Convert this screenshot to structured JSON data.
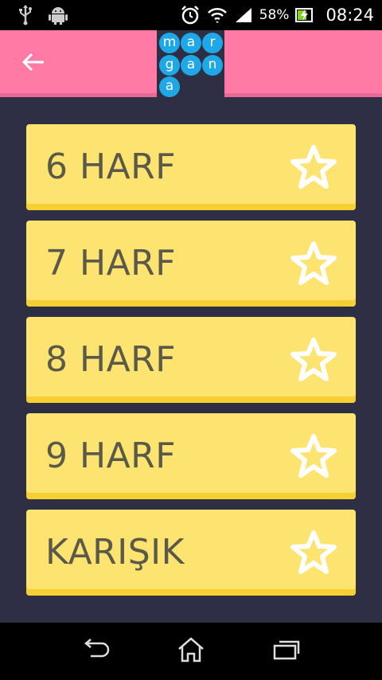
{
  "status_bar": {
    "battery_percent": "58%",
    "time": "08:24",
    "icons": [
      "usb-icon",
      "android-icon",
      "alarm-icon",
      "wifi-icon",
      "signal-icon",
      "battery-charging-icon"
    ]
  },
  "header": {
    "back_icon": "arrow-left-icon",
    "logo_letters": [
      "m",
      "a",
      "r",
      "g",
      "a",
      "n",
      "a"
    ],
    "color": "#ff7aa5"
  },
  "levels": [
    {
      "label": "6 HARF",
      "icon": "star-icon"
    },
    {
      "label": "7 HARF",
      "icon": "star-icon"
    },
    {
      "label": "8 HARF",
      "icon": "star-icon"
    },
    {
      "label": "9 HARF",
      "icon": "star-icon"
    },
    {
      "label": "KARIŞIK",
      "icon": "star-icon"
    }
  ],
  "colors": {
    "background": "#2e2f45",
    "card": "#fde36f",
    "logo_bubble": "#1fa8e8"
  },
  "nav_bar": {
    "icons": [
      "back-icon",
      "home-icon",
      "recent-apps-icon"
    ]
  }
}
